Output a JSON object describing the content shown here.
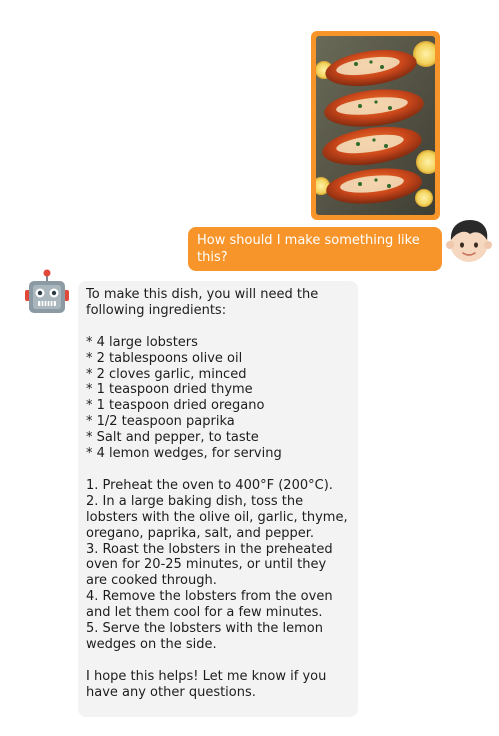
{
  "chat": {
    "user_message": {
      "text": "How should I make something like this?",
      "image_description": "roasted lobster tails with herbs and lemon slices"
    },
    "bot_message": {
      "text": "To make this dish, you will need the following ingredients:\n\n* 4 large lobsters\n* 2 tablespoons olive oil\n* 2 cloves garlic, minced\n* 1 teaspoon dried thyme\n* 1 teaspoon dried oregano\n* 1/2 teaspoon paprika\n* Salt and pepper, to taste\n* 4 lemon wedges, for serving\n\n1. Preheat the oven to 400°F (200°C).\n2. In a large baking dish, toss the lobsters with the olive oil, garlic, thyme, oregano, paprika, salt, and pepper.\n3. Roast the lobsters in the preheated oven for 20-25 minutes, or until they are cooked through.\n4. Remove the lobsters from the oven and let them cool for a few minutes.\n5. Serve the lobsters with the lemon wedges on the side.\n\nI hope this helps! Let me know if you have any other questions."
    }
  },
  "colors": {
    "user_bubble": "#f7952a",
    "bot_bubble": "#f3f3f4",
    "bot_text": "#1d1d1d"
  },
  "icons": {
    "user_avatar": "boy-face-icon",
    "bot_avatar": "robot-face-icon"
  }
}
